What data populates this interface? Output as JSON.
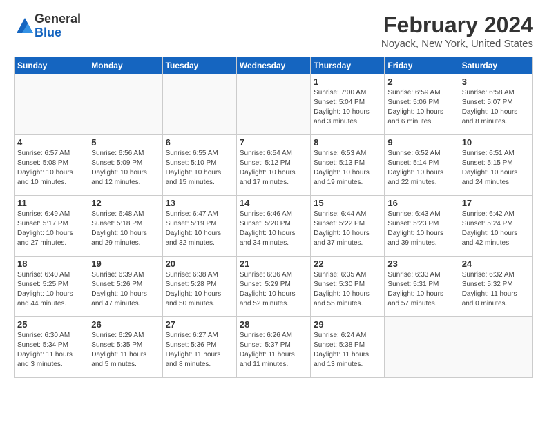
{
  "header": {
    "logo_general": "General",
    "logo_blue": "Blue",
    "title": "February 2024",
    "subtitle": "Noyack, New York, United States"
  },
  "weekdays": [
    "Sunday",
    "Monday",
    "Tuesday",
    "Wednesday",
    "Thursday",
    "Friday",
    "Saturday"
  ],
  "weeks": [
    [
      {
        "day": "",
        "info": ""
      },
      {
        "day": "",
        "info": ""
      },
      {
        "day": "",
        "info": ""
      },
      {
        "day": "",
        "info": ""
      },
      {
        "day": "1",
        "info": "Sunrise: 7:00 AM\nSunset: 5:04 PM\nDaylight: 10 hours\nand 3 minutes."
      },
      {
        "day": "2",
        "info": "Sunrise: 6:59 AM\nSunset: 5:06 PM\nDaylight: 10 hours\nand 6 minutes."
      },
      {
        "day": "3",
        "info": "Sunrise: 6:58 AM\nSunset: 5:07 PM\nDaylight: 10 hours\nand 8 minutes."
      }
    ],
    [
      {
        "day": "4",
        "info": "Sunrise: 6:57 AM\nSunset: 5:08 PM\nDaylight: 10 hours\nand 10 minutes."
      },
      {
        "day": "5",
        "info": "Sunrise: 6:56 AM\nSunset: 5:09 PM\nDaylight: 10 hours\nand 12 minutes."
      },
      {
        "day": "6",
        "info": "Sunrise: 6:55 AM\nSunset: 5:10 PM\nDaylight: 10 hours\nand 15 minutes."
      },
      {
        "day": "7",
        "info": "Sunrise: 6:54 AM\nSunset: 5:12 PM\nDaylight: 10 hours\nand 17 minutes."
      },
      {
        "day": "8",
        "info": "Sunrise: 6:53 AM\nSunset: 5:13 PM\nDaylight: 10 hours\nand 19 minutes."
      },
      {
        "day": "9",
        "info": "Sunrise: 6:52 AM\nSunset: 5:14 PM\nDaylight: 10 hours\nand 22 minutes."
      },
      {
        "day": "10",
        "info": "Sunrise: 6:51 AM\nSunset: 5:15 PM\nDaylight: 10 hours\nand 24 minutes."
      }
    ],
    [
      {
        "day": "11",
        "info": "Sunrise: 6:49 AM\nSunset: 5:17 PM\nDaylight: 10 hours\nand 27 minutes."
      },
      {
        "day": "12",
        "info": "Sunrise: 6:48 AM\nSunset: 5:18 PM\nDaylight: 10 hours\nand 29 minutes."
      },
      {
        "day": "13",
        "info": "Sunrise: 6:47 AM\nSunset: 5:19 PM\nDaylight: 10 hours\nand 32 minutes."
      },
      {
        "day": "14",
        "info": "Sunrise: 6:46 AM\nSunset: 5:20 PM\nDaylight: 10 hours\nand 34 minutes."
      },
      {
        "day": "15",
        "info": "Sunrise: 6:44 AM\nSunset: 5:22 PM\nDaylight: 10 hours\nand 37 minutes."
      },
      {
        "day": "16",
        "info": "Sunrise: 6:43 AM\nSunset: 5:23 PM\nDaylight: 10 hours\nand 39 minutes."
      },
      {
        "day": "17",
        "info": "Sunrise: 6:42 AM\nSunset: 5:24 PM\nDaylight: 10 hours\nand 42 minutes."
      }
    ],
    [
      {
        "day": "18",
        "info": "Sunrise: 6:40 AM\nSunset: 5:25 PM\nDaylight: 10 hours\nand 44 minutes."
      },
      {
        "day": "19",
        "info": "Sunrise: 6:39 AM\nSunset: 5:26 PM\nDaylight: 10 hours\nand 47 minutes."
      },
      {
        "day": "20",
        "info": "Sunrise: 6:38 AM\nSunset: 5:28 PM\nDaylight: 10 hours\nand 50 minutes."
      },
      {
        "day": "21",
        "info": "Sunrise: 6:36 AM\nSunset: 5:29 PM\nDaylight: 10 hours\nand 52 minutes."
      },
      {
        "day": "22",
        "info": "Sunrise: 6:35 AM\nSunset: 5:30 PM\nDaylight: 10 hours\nand 55 minutes."
      },
      {
        "day": "23",
        "info": "Sunrise: 6:33 AM\nSunset: 5:31 PM\nDaylight: 10 hours\nand 57 minutes."
      },
      {
        "day": "24",
        "info": "Sunrise: 6:32 AM\nSunset: 5:32 PM\nDaylight: 11 hours\nand 0 minutes."
      }
    ],
    [
      {
        "day": "25",
        "info": "Sunrise: 6:30 AM\nSunset: 5:34 PM\nDaylight: 11 hours\nand 3 minutes."
      },
      {
        "day": "26",
        "info": "Sunrise: 6:29 AM\nSunset: 5:35 PM\nDaylight: 11 hours\nand 5 minutes."
      },
      {
        "day": "27",
        "info": "Sunrise: 6:27 AM\nSunset: 5:36 PM\nDaylight: 11 hours\nand 8 minutes."
      },
      {
        "day": "28",
        "info": "Sunrise: 6:26 AM\nSunset: 5:37 PM\nDaylight: 11 hours\nand 11 minutes."
      },
      {
        "day": "29",
        "info": "Sunrise: 6:24 AM\nSunset: 5:38 PM\nDaylight: 11 hours\nand 13 minutes."
      },
      {
        "day": "",
        "info": ""
      },
      {
        "day": "",
        "info": ""
      }
    ]
  ]
}
